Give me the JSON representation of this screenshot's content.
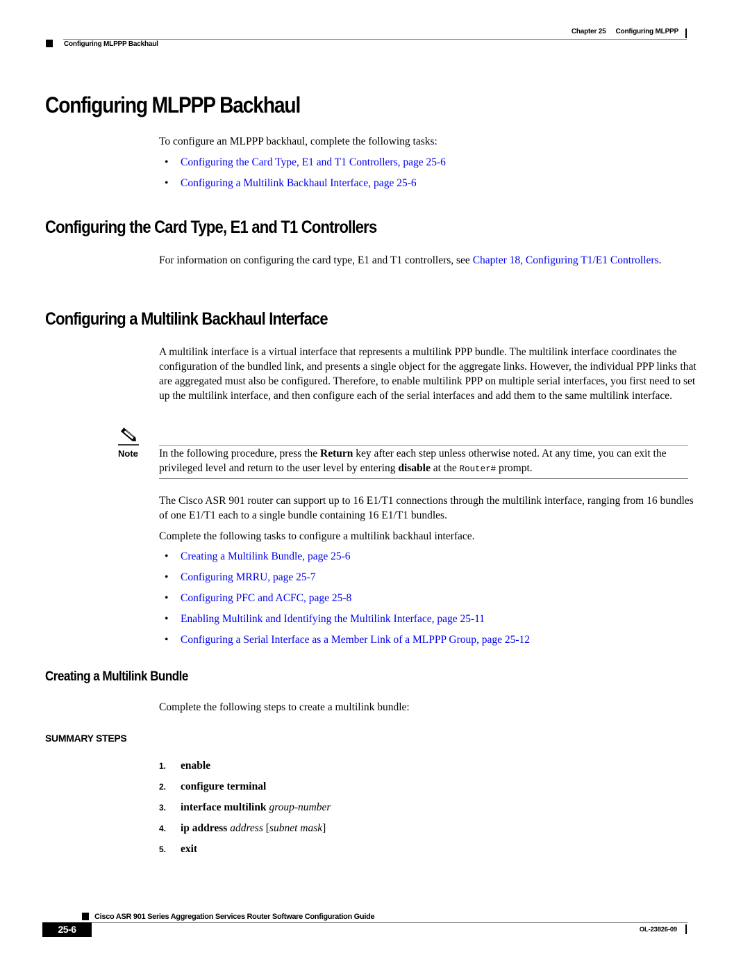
{
  "header": {
    "chapter": "Chapter 25",
    "chapter_title": "Configuring MLPPP",
    "section": "Configuring MLPPP Backhaul"
  },
  "title": "Configuring MLPPP Backhaul",
  "intro": "To configure an MLPPP backhaul, complete the following tasks:",
  "intro_links": [
    "Configuring the Card Type, E1 and T1 Controllers, page 25-6",
    "Configuring a Multilink Backhaul Interface, page 25-6"
  ],
  "section_card": {
    "heading": "Configuring the Card Type, E1 and T1 Controllers",
    "text_before": "For information on configuring the card type, E1 and T1 controllers, see ",
    "link": "Chapter 18, Configuring T1/E1 Controllers",
    "text_after": "."
  },
  "section_multilink": {
    "heading": "Configuring a Multilink Backhaul Interface",
    "paragraph": "A multilink interface is a virtual interface that represents a multilink PPP bundle. The multilink interface coordinates the configuration of the bundled link, and presents a single object for the aggregate links. However, the individual PPP links that are aggregated must also be configured. Therefore, to enable multilink PPP on multiple serial interfaces, you first need to set up the multilink interface, and then configure each of the serial interfaces and add them to the same multilink interface.",
    "note": {
      "label": "Note",
      "t1": "In the following procedure, press the ",
      "b1": "Return",
      "t2": " key after each step unless otherwise noted. At any time, you can exit the privileged level and return to the user level by entering ",
      "b2": "disable",
      "t3": " at the ",
      "code": "Router#",
      "t4": " prompt."
    },
    "paragraph2": "The Cisco ASR 901 router can support up to 16 E1/T1 connections through the multilink interface, ranging from 16 bundles of one E1/T1 each to a single bundle containing 16 E1/T1 bundles.",
    "paragraph3": "Complete the following tasks to configure a multilink backhaul interface.",
    "task_links": [
      "Creating a Multilink Bundle, page 25-6",
      "Configuring MRRU, page 25-7",
      "Configuring PFC and ACFC, page 25-8",
      "Enabling Multilink and Identifying the Multilink Interface, page 25-11",
      "Configuring a Serial Interface as a Member Link of a MLPPP Group, page 25-12"
    ]
  },
  "section_bundle": {
    "heading": "Creating a Multilink Bundle",
    "text": "Complete the following steps to create a multilink bundle:",
    "summary_label": "SUMMARY STEPS",
    "steps": [
      {
        "num": "1.",
        "cmd": "enable",
        "arg": ""
      },
      {
        "num": "2.",
        "cmd": "configure terminal",
        "arg": ""
      },
      {
        "num": "3.",
        "cmd": "interface multilink",
        "arg": "group-number"
      },
      {
        "num": "4.",
        "cmd": "ip address",
        "arg": "address",
        "bracket_open": "[",
        "arg2": "subnet mask",
        "bracket_close": "]"
      },
      {
        "num": "5.",
        "cmd": "exit",
        "arg": ""
      }
    ]
  },
  "footer": {
    "title": "Cisco ASR 901 Series Aggregation Services Router Software Configuration Guide",
    "page": "25-6",
    "doc_id": "OL-23826-09"
  }
}
